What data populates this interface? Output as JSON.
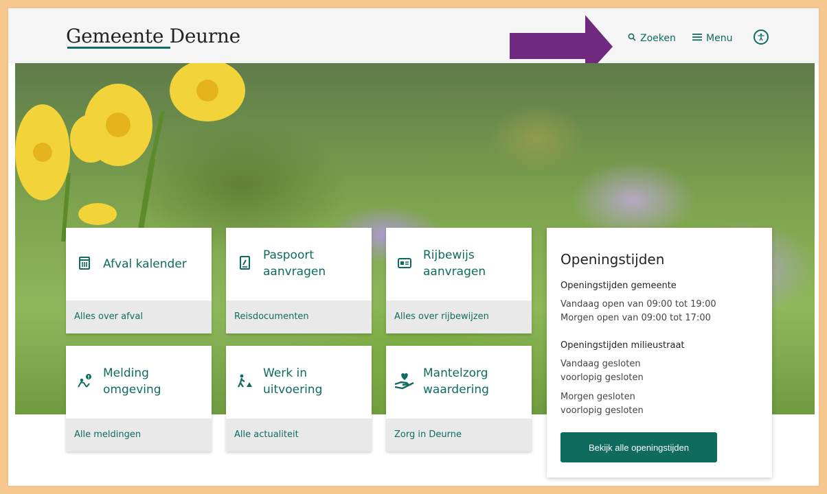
{
  "header": {
    "logo": "Gemeente Deurne",
    "search_label": "Zoeken",
    "menu_label": "Menu"
  },
  "tiles": [
    {
      "title_line1": "Afval kalender",
      "title_line2": "",
      "footer": "Alles over afval",
      "icon": "trash-calendar-icon"
    },
    {
      "title_line1": "Paspoort",
      "title_line2": "aanvragen",
      "footer": "Reisdocumenten",
      "icon": "passport-icon"
    },
    {
      "title_line1": "Rijbewijs",
      "title_line2": "aanvragen",
      "footer": "Alles over rijbewijzen",
      "icon": "id-card-icon"
    },
    {
      "title_line1": "Melding",
      "title_line2": "omgeving",
      "footer": "Alle meldingen",
      "icon": "report-icon"
    },
    {
      "title_line1": "Werk in",
      "title_line2": "uitvoering",
      "footer": "Alle actualiteit",
      "icon": "roadwork-icon"
    },
    {
      "title_line1": "Mantelzorg",
      "title_line2": "waardering",
      "footer": "Zorg in Deurne",
      "icon": "heart-hand-icon"
    }
  ],
  "hours": {
    "title": "Openingstijden",
    "municipality_heading": "Openingstijden gemeente",
    "municipality_today": "Vandaag open van 09:00 tot 19:00",
    "municipality_tomorrow": "Morgen open van 09:00 tot 17:00",
    "recycling_heading": "Openingstijden milieustraat",
    "recycling_today": "Vandaag gesloten",
    "recycling_today_note": "voorlopig gesloten",
    "recycling_tomorrow": "Morgen gesloten",
    "recycling_tomorrow_note": "voorlopig gesloten",
    "button_label": "Bekijk alle openingstijden"
  },
  "colors": {
    "accent": "#0e6b5e",
    "annotation_arrow": "#6f2a7f",
    "frame": "#f6c890"
  }
}
